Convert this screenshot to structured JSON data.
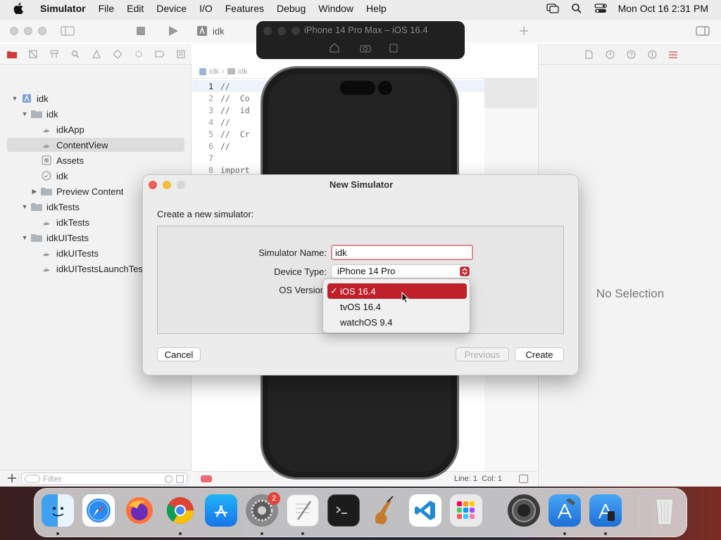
{
  "menubar": {
    "app_name": "Simulator",
    "items": [
      "File",
      "Edit",
      "Device",
      "I/O",
      "Features",
      "Debug",
      "Window",
      "Help"
    ],
    "clock": "Mon Oct 16  2:31 PM"
  },
  "xcode": {
    "tab_title": "idk",
    "jump_path": [
      "idk",
      "idk"
    ],
    "navigator": {
      "tree": [
        {
          "label": "idk",
          "level": 0,
          "icon": "project-icon",
          "disclosure": "open"
        },
        {
          "label": "idk",
          "level": 1,
          "icon": "folder-icon",
          "disclosure": "open"
        },
        {
          "label": "idkApp",
          "level": 2,
          "icon": "swift-file-icon",
          "disclosure": ""
        },
        {
          "label": "ContentView",
          "level": 2,
          "icon": "swift-file-icon",
          "disclosure": "",
          "selected": true
        },
        {
          "label": "Assets",
          "level": 2,
          "icon": "assets-icon",
          "disclosure": ""
        },
        {
          "label": "idk",
          "level": 2,
          "icon": "entitlements-icon",
          "disclosure": ""
        },
        {
          "label": "Preview Content",
          "level": 2,
          "icon": "folder-icon",
          "disclosure": "closed"
        },
        {
          "label": "idkTests",
          "level": 1,
          "icon": "folder-icon",
          "disclosure": "open"
        },
        {
          "label": "idkTests",
          "level": 2,
          "icon": "swift-file-icon",
          "disclosure": ""
        },
        {
          "label": "idkUITests",
          "level": 1,
          "icon": "folder-icon",
          "disclosure": "open"
        },
        {
          "label": "idkUITests",
          "level": 2,
          "icon": "swift-file-icon",
          "disclosure": ""
        },
        {
          "label": "idkUITestsLaunchTests",
          "level": 2,
          "icon": "swift-file-icon",
          "disclosure": ""
        }
      ],
      "filter_placeholder": "Filter"
    },
    "editor": {
      "lines": [
        {
          "num": "1",
          "code": "//"
        },
        {
          "num": "2",
          "code": "//  Co"
        },
        {
          "num": "3",
          "code": "//  id"
        },
        {
          "num": "4",
          "code": "//"
        },
        {
          "num": "5",
          "code": "//  Cr"
        },
        {
          "num": "6",
          "code": "//"
        },
        {
          "num": "7",
          "code": ""
        },
        {
          "num": "8",
          "code": "import"
        }
      ],
      "status": "Line: 1  Col: 1"
    },
    "inspector": {
      "empty_text": "No Selection"
    }
  },
  "simulator": {
    "title": "iPhone 14 Pro Max – iOS 16.4"
  },
  "dialog": {
    "title": "New Simulator",
    "prompt": "Create a new simulator:",
    "name_label": "Simulator Name:",
    "name_value": "idk",
    "device_label": "Device Type:",
    "device_value": "iPhone 14 Pro",
    "os_label": "OS Version",
    "os_options": [
      {
        "label": "iOS 16.4",
        "selected": true
      },
      {
        "label": "tvOS 16.4",
        "selected": false
      },
      {
        "label": "watchOS 9.4",
        "selected": false
      }
    ],
    "cancel": "Cancel",
    "previous": "Previous",
    "create": "Create"
  },
  "dock": {
    "apps": [
      "Finder",
      "Safari",
      "Firefox",
      "Chrome",
      "App Store",
      "System Settings",
      "TextEdit",
      "Terminal",
      "GarageBand",
      "VS Code",
      "Launchpad",
      "Compressor",
      "Xcode",
      "Simulator",
      "Trash"
    ],
    "badge": "2"
  },
  "colors": {
    "accent": "#c0202a",
    "selection": "#dcdcdc"
  }
}
